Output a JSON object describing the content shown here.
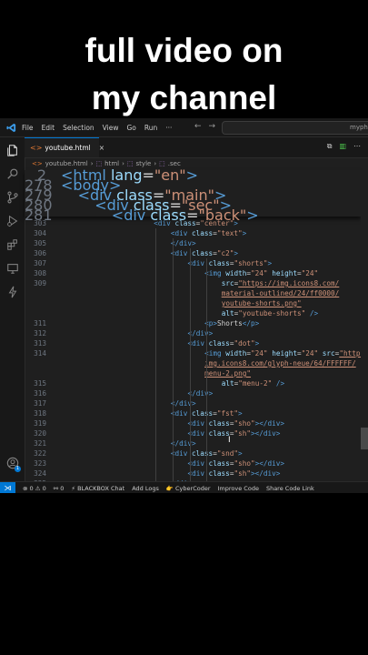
{
  "caption": {
    "line1": "full video on",
    "line2": "my channel"
  },
  "menu": [
    "File",
    "Edit",
    "Selection",
    "View",
    "Go",
    "Run",
    "···"
  ],
  "search": {
    "text": "mypho"
  },
  "tab": {
    "label": "youtube.html"
  },
  "breadcrumb": {
    "file": "youtube.html",
    "items": [
      "html",
      "style",
      ".sec"
    ],
    "sep": "›"
  },
  "sticky_lines": [
    {
      "num": "2",
      "indent": 0,
      "html": "<span class=\"t\">&lt;html</span> <span class=\"a\">lang</span>=<span class=\"s\">\"en\"</span><span class=\"t\">&gt;</span>"
    },
    {
      "num": "278",
      "indent": 0,
      "html": "<span class=\"t\">&lt;body&gt;</span>"
    },
    {
      "num": "279",
      "indent": 2,
      "html": "<span class=\"t\">&lt;div</span> <span class=\"a\">class</span>=<span class=\"s\">\"main\"</span><span class=\"t\">&gt;</span>"
    },
    {
      "num": "280",
      "indent": 4,
      "html": "<span class=\"t\">&lt;div</span> <span class=\"a\">class</span>=<span class=\"s\">\"sec\"</span><span class=\"t\">&gt;</span>"
    },
    {
      "num": "281",
      "indent": 6,
      "html": "<span class=\"t\">&lt;div</span> <span class=\"a\">class</span>=<span class=\"s\">\"back\"</span><span class=\"t\">&gt;</span>"
    }
  ],
  "code_lines": [
    {
      "num": "303",
      "indent": 11,
      "html": "<span class=\"t\">&lt;div</span> <span class=\"a\">class</span>=<span class=\"s\">\"center\"</span><span class=\"t\">&gt;</span>"
    },
    {
      "num": "304",
      "indent": 13,
      "html": "<span class=\"t\">&lt;div</span> <span class=\"a\">class</span>=<span class=\"s\">\"text\"</span><span class=\"t\">&gt;</span>"
    },
    {
      "num": "305",
      "indent": 13,
      "html": "<span class=\"t\">&lt;/div&gt;</span>"
    },
    {
      "num": "306",
      "indent": 13,
      "html": "<span class=\"t\">&lt;div</span> <span class=\"a\">class</span>=<span class=\"s\">\"c2\"</span><span class=\"t\">&gt;</span>"
    },
    {
      "num": "307",
      "indent": 15,
      "html": "<span class=\"t\">&lt;div</span> <span class=\"a\">class</span>=<span class=\"s\">\"shorts\"</span><span class=\"t\">&gt;</span>"
    },
    {
      "num": "308",
      "indent": 17,
      "html": "<span class=\"t\">&lt;img</span> <span class=\"a\">width</span>=<span class=\"s\">\"24\"</span> <span class=\"a\">height</span>=<span class=\"s\">\"24\"</span>"
    },
    {
      "num": "309",
      "indent": 19,
      "html": "<span class=\"a\">src</span>=<span class=\"s u\">\"https://img.icons8.com/</span>"
    },
    {
      "num": "",
      "indent": 19,
      "html": "<span class=\"s u\">material-outlined/24/ff0000/</span>"
    },
    {
      "num": "",
      "indent": 19,
      "html": "<span class=\"s u\">youtube-shorts.png\"</span>"
    },
    {
      "num": "",
      "indent": 19,
      "html": "<span class=\"a\">alt</span>=<span class=\"s\">\"youtube-shorts\"</span> <span class=\"t\">/&gt;</span>"
    },
    {
      "num": "311",
      "indent": 17,
      "html": "<span class=\"t\">&lt;p&gt;</span><span class=\"x\">Shorts</span><span class=\"t\">&lt;/p&gt;</span>"
    },
    {
      "num": "312",
      "indent": 15,
      "html": "<span class=\"t\">&lt;/div&gt;</span>"
    },
    {
      "num": "313",
      "indent": 15,
      "html": "<span class=\"t\">&lt;div</span> <span class=\"a\">class</span>=<span class=\"s\">\"dot\"</span><span class=\"t\">&gt;</span>"
    },
    {
      "num": "314",
      "indent": 17,
      "html": "<span class=\"t\">&lt;img</span> <span class=\"a\">width</span>=<span class=\"s\">\"24\"</span> <span class=\"a\">height</span>=<span class=\"s\">\"24\"</span> <span class=\"a\">src</span>=<span class=\"s u\">\"https://</span>"
    },
    {
      "num": "",
      "indent": 17,
      "html": "<span class=\"s u\">img.icons8.com/glyph-neue/64/FFFFFF/</span>"
    },
    {
      "num": "",
      "indent": 17,
      "html": "<span class=\"s u\">menu-2.png\"</span>"
    },
    {
      "num": "315",
      "indent": 19,
      "html": "<span class=\"a\">alt</span>=<span class=\"s\">\"menu-2\"</span> <span class=\"t\">/&gt;</span>"
    },
    {
      "num": "316",
      "indent": 15,
      "html": "<span class=\"t\">&lt;/div&gt;</span>"
    },
    {
      "num": "317",
      "indent": 13,
      "html": "<span class=\"t\">&lt;/div&gt;</span>"
    },
    {
      "num": "318",
      "indent": 13,
      "html": "<span class=\"t\">&lt;div</span> <span class=\"a\">class</span>=<span class=\"s\">\"fst\"</span><span class=\"t\">&gt;</span>"
    },
    {
      "num": "319",
      "indent": 15,
      "html": "<span class=\"t\">&lt;div</span> <span class=\"a\">class</span>=<span class=\"s\">\"sho\"</span><span class=\"t\">&gt;&lt;/div&gt;</span>"
    },
    {
      "num": "320",
      "indent": 15,
      "html": "<span class=\"t\">&lt;div</span> <span class=\"a\">class</span>=<span class=\"s\">\"sh\"</span><span class=\"t\">&gt;&lt;/div&gt;</span>"
    },
    {
      "num": "321",
      "indent": 13,
      "html": "<span class=\"t\">&lt;/div&gt;</span>"
    },
    {
      "num": "322",
      "indent": 13,
      "html": "<span class=\"t\">&lt;div</span> <span class=\"a\">class</span>=<span class=\"s\">\"snd\"</span><span class=\"t\">&gt;</span>"
    },
    {
      "num": "323",
      "indent": 15,
      "html": "<span class=\"t\">&lt;div</span> <span class=\"a\">class</span>=<span class=\"s\">\"sho\"</span><span class=\"t\">&gt;&lt;/div&gt;</span>"
    },
    {
      "num": "324",
      "indent": 15,
      "html": "<span class=\"t\">&lt;div</span> <span class=\"a\">class</span>=<span class=\"s\">\"sh\"</span><span class=\"t\">&gt;&lt;/div&gt;</span>"
    },
    {
      "num": "325",
      "indent": 13,
      "html": "<span class=\"t\">&lt;/div&gt;</span>"
    }
  ],
  "status": {
    "errors": "0",
    "warnings": "0",
    "ports": "0",
    "items": [
      "BLACKBOX Chat",
      "Add Logs",
      "CyberCoder",
      "Improve Code",
      "Share Code Link"
    ]
  },
  "badge": "1",
  "colors": {
    "accent": "#0078d4",
    "tag": "#569cd6",
    "attr": "#9cdcfe",
    "string": "#ce9178"
  }
}
